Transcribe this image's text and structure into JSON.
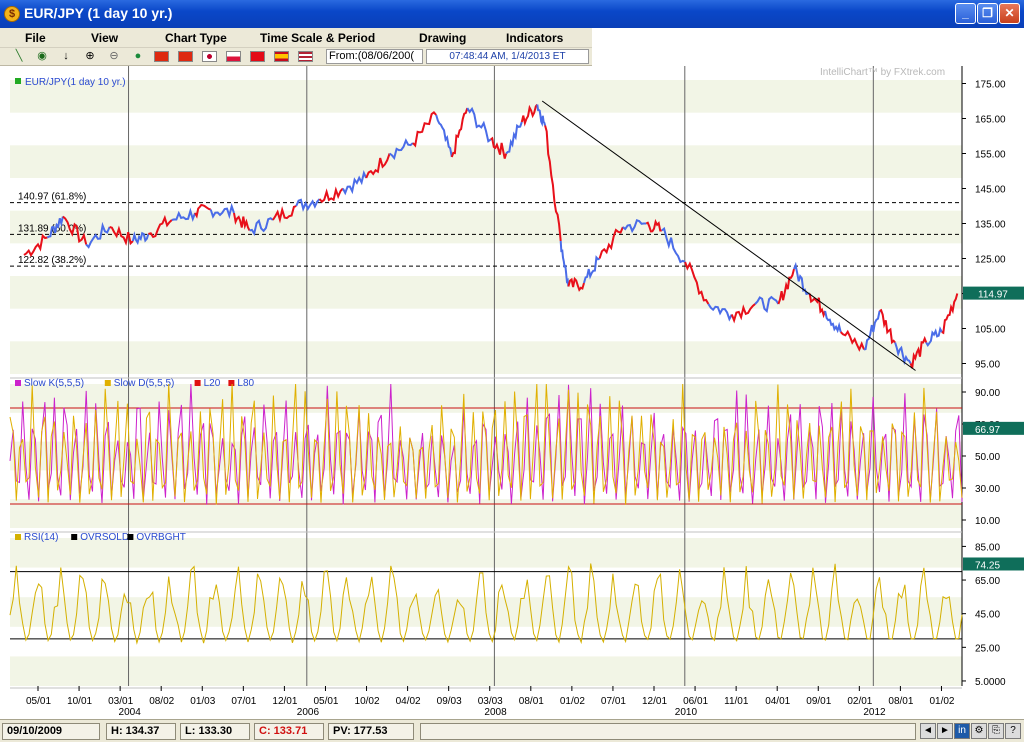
{
  "window": {
    "title": "EUR/JPY (1 day  10 yr.)",
    "app_icon": "fx-coin-icon",
    "buttons": [
      "minimize",
      "restore",
      "close"
    ]
  },
  "menu": [
    "File",
    "View",
    "Chart Type",
    "Time Scale & Period",
    "Drawing",
    "Indicators"
  ],
  "toolbar": {
    "from_label": "From:(08/06/200(",
    "time_display": "07:48:44 AM, 1/4/2013 ET",
    "flags": [
      "china",
      "hong-kong",
      "japan",
      "poland",
      "turkey",
      "spain",
      "usa"
    ]
  },
  "watermark": "IntelliChart™ by FXtrek.com",
  "chart_data": [
    {
      "type": "line",
      "title": "EUR/JPY(1 day  10 yr.)",
      "legend_color": "#22aa22",
      "series_colors": [
        "#e8101a",
        "#4a6ce8"
      ],
      "yticks": [
        "175.00",
        "165.00",
        "155.00",
        "145.00",
        "135.00",
        "125.00",
        "115.00",
        "105.00",
        "95.00"
      ],
      "ylim": [
        92,
        176
      ],
      "current_value": "114.97",
      "fib_levels": [
        {
          "value": 140.97,
          "label": "140.97 (61.8%)"
        },
        {
          "value": 131.89,
          "label": "131.89 (50.0%)"
        },
        {
          "value": 122.82,
          "label": "122.82 (38.2%)"
        }
      ],
      "trendline": [
        {
          "x": "2008-07-20",
          "y": 170
        },
        {
          "x": "2012-07-20",
          "y": 93
        }
      ],
      "points": [
        [
          "2003-01",
          126
        ],
        [
          "2003-04",
          131
        ],
        [
          "2003-06",
          137
        ],
        [
          "2003-09",
          129
        ],
        [
          "2003-12",
          134
        ],
        [
          "2004-03",
          130
        ],
        [
          "2004-05",
          132
        ],
        [
          "2004-08",
          136
        ],
        [
          "2004-11",
          138
        ],
        [
          "2005-01",
          139
        ],
        [
          "2005-04",
          138
        ],
        [
          "2005-06",
          133
        ],
        [
          "2005-09",
          136
        ],
        [
          "2005-12",
          140
        ],
        [
          "2006-03",
          142
        ],
        [
          "2006-06",
          145
        ],
        [
          "2006-09",
          148
        ],
        [
          "2006-12",
          155
        ],
        [
          "2007-03",
          158
        ],
        [
          "2007-06",
          166
        ],
        [
          "2007-08",
          154
        ],
        [
          "2007-10",
          168
        ],
        [
          "2008-01",
          159
        ],
        [
          "2008-03",
          155
        ],
        [
          "2008-05",
          164
        ],
        [
          "2008-07",
          169
        ],
        [
          "2008-08",
          163
        ],
        [
          "2008-10",
          130
        ],
        [
          "2008-11",
          117
        ],
        [
          "2009-01",
          118
        ],
        [
          "2009-03",
          125
        ],
        [
          "2009-06",
          134
        ],
        [
          "2009-09",
          135
        ],
        [
          "2009-11",
          133
        ],
        [
          "2010-02",
          124
        ],
        [
          "2010-05",
          112
        ],
        [
          "2010-08",
          109
        ],
        [
          "2010-11",
          112
        ],
        [
          "2011-02",
          112
        ],
        [
          "2011-04",
          122
        ],
        [
          "2011-06",
          115
        ],
        [
          "2011-08",
          110
        ],
        [
          "2011-10",
          104
        ],
        [
          "2012-01",
          99
        ],
        [
          "2012-03",
          110
        ],
        [
          "2012-05",
          101
        ],
        [
          "2012-07",
          95
        ],
        [
          "2012-09",
          101
        ],
        [
          "2012-11",
          104
        ],
        [
          "2013-01",
          115
        ]
      ],
      "xticks": [
        "05/01",
        "10/01",
        "03/01",
        "08/02",
        "01/03",
        "07/01",
        "12/01",
        "05/01",
        "10/02",
        "04/02",
        "09/03",
        "03/03",
        "08/01",
        "01/02",
        "07/01",
        "12/01",
        "06/01",
        "11/01",
        "04/01",
        "09/01",
        "02/01",
        "08/01",
        "01/02"
      ],
      "year_labels": [
        "2004",
        "2006",
        "2008",
        "2010",
        "2012"
      ]
    },
    {
      "type": "line",
      "legend": [
        {
          "name": "Slow K(5,5,5)",
          "color": "#cc22cc"
        },
        {
          "name": "Slow D(5,5,5)",
          "color": "#e0b000"
        },
        {
          "name": "L20",
          "color": "#e01010"
        },
        {
          "name": "L80",
          "color": "#e01010"
        }
      ],
      "yticks": [
        "90.00",
        "70.00",
        "50.00",
        "30.00",
        "10.00"
      ],
      "ylim": [
        5,
        95
      ],
      "levels": [
        80,
        20
      ],
      "current_value": "66.97"
    },
    {
      "type": "line",
      "legend": [
        {
          "name": "RSI(14)",
          "color": "#d4b000"
        },
        {
          "name": "OVRSOLD",
          "color": "#000000"
        },
        {
          "name": "OVRBGHT",
          "color": "#000000"
        }
      ],
      "yticks": [
        "85.00",
        "65.00",
        "45.00",
        "25.00",
        "5.0000"
      ],
      "ylim": [
        2,
        90
      ],
      "levels": [
        70,
        30
      ],
      "current_value": "74.25"
    }
  ],
  "status": {
    "date": "09/10/2009",
    "high": "H: 134.37",
    "low": "L: 133.30",
    "close": "C: 133.71",
    "pv": "PV: 177.53"
  }
}
